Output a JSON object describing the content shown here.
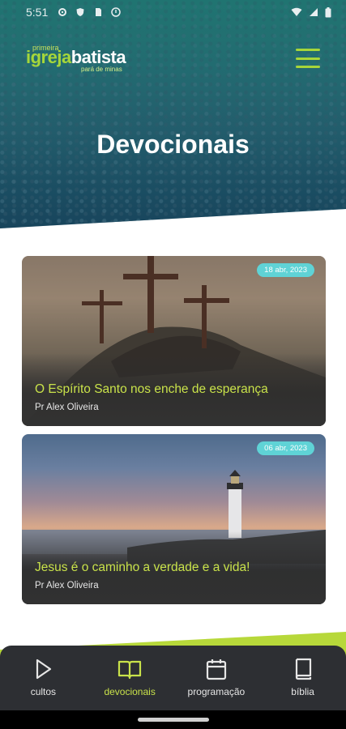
{
  "status_bar": {
    "time": "5:51",
    "left_icons": [
      "gear-icon",
      "shield-icon",
      "sim-icon",
      "alert-icon"
    ],
    "right_icons": [
      "wifi-icon",
      "signal-icon",
      "battery-icon"
    ]
  },
  "header": {
    "logo": {
      "small": "primeira",
      "igreja": "igreja",
      "batista": "batista",
      "sub": "pará de minas"
    },
    "title": "Devocionais"
  },
  "devotionals": [
    {
      "date": "18 abr, 2023",
      "title": "O Espírito Santo nos enche de esperança",
      "author": "Pr Alex Oliveira",
      "image": "three-crosses-on-hill"
    },
    {
      "date": "06 abr, 2023",
      "title": "Jesus é o caminho a verdade e a vida!",
      "author": "Pr Alex Oliveira",
      "image": "lighthouse-at-dusk"
    }
  ],
  "bottom_nav": [
    {
      "label": "cultos",
      "icon": "play-icon",
      "active": false
    },
    {
      "label": "devocionais",
      "icon": "open-book-icon",
      "active": true
    },
    {
      "label": "programação",
      "icon": "calendar-icon",
      "active": false
    },
    {
      "label": "bíblia",
      "icon": "bible-icon",
      "active": false
    }
  ],
  "colors": {
    "accent_green": "#b7d83a",
    "title_green": "#c9e24a",
    "badge": "#5fd3d6",
    "nav_bg": "#2d2f33"
  }
}
